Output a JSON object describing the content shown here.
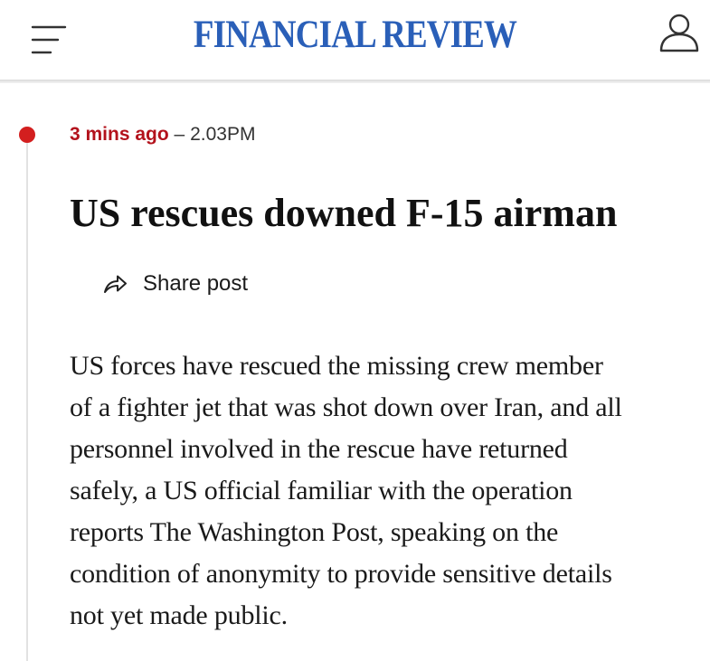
{
  "header": {
    "masthead": "FINANCIAL REVIEW",
    "menu_icon": "hamburger-menu-icon",
    "account_icon": "user-account-icon",
    "brand_color": "#2a5fb8"
  },
  "post": {
    "relative_time": "3 mins ago",
    "separator": "–",
    "time": "2.03PM",
    "headline": "US rescues downed F-15 airman",
    "share_label": "Share post",
    "share_icon": "share-arrow-icon",
    "accent_color": "#d31f1f",
    "body_lines": [
      "US forces have rescued the missing crew member",
      "of a fighter jet that was shot down over Iran, and all",
      "personnel involved in the rescue have returned",
      "safely, a US official familiar with the operation",
      "reports The Washington Post, speaking on the",
      "condition of anonymity to provide sensitive details",
      "not yet made public."
    ]
  }
}
